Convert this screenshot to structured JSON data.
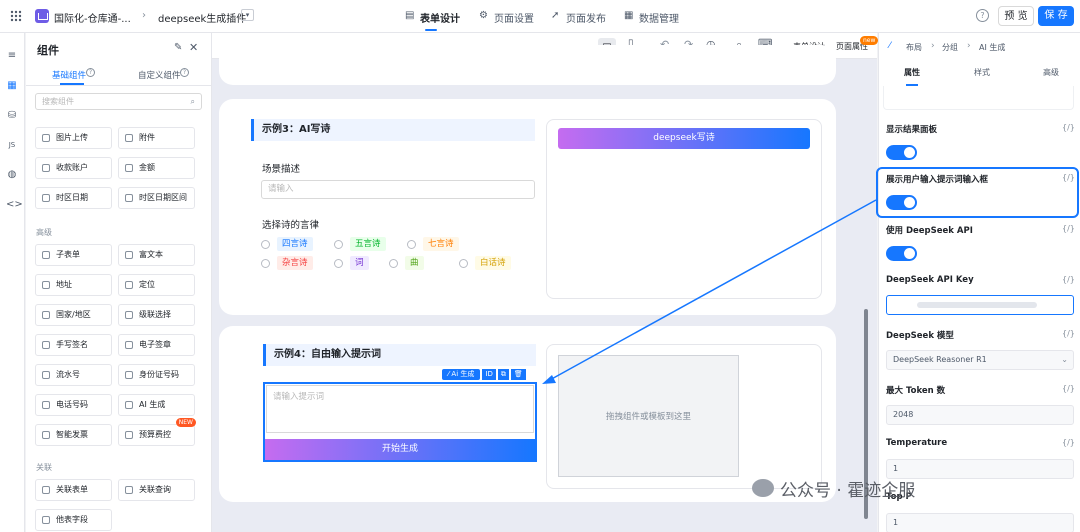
{
  "topbar": {
    "app_title": "国际化-仓库通-...",
    "page_name": "deepseek生成插件",
    "tabs": [
      "表单设计",
      "页面设置",
      "页面发布",
      "数据管理"
    ],
    "preview_label": "预 览",
    "save_label": "保 存"
  },
  "left_panel": {
    "title": "组件",
    "tabs": [
      "基础组件",
      "自定义组件"
    ],
    "search_placeholder": "搜索组件",
    "basic_items": [
      "图片上传",
      "附件",
      "收款账户",
      "金额",
      "时区日期",
      "时区日期区间"
    ],
    "advanced_group": "高级",
    "advanced_items": [
      "子表单",
      "富文本",
      "地址",
      "定位",
      "国家/地区",
      "级联选择",
      "手写签名",
      "电子签章",
      "流水号",
      "身份证号码",
      "电话号码",
      "AI 生成",
      "智能发票",
      "预算费控"
    ],
    "new_badge": "NEW",
    "relation_group": "关联",
    "relation_items": [
      "关联表单",
      "关联查询",
      "他表字段"
    ]
  },
  "canvas_toolbar": {
    "form_settings": "表单设计",
    "page_props": "页面属性",
    "new_badge": "new"
  },
  "canvas": {
    "example3_title": "示例3：AI写诗",
    "deepseek_button": "deepseek写诗",
    "scene_label": "场景描述",
    "scene_placeholder": "请输入",
    "poem_label": "选择诗的言律",
    "poem_options": [
      "四言诗",
      "五言诗",
      "七言诗",
      "杂言诗",
      "词",
      "曲",
      "白话诗"
    ],
    "example4_title": "示例4：自由输入提示词",
    "ai_toolbar_label": "Ai 生成",
    "ai_toolbar_id": "ID",
    "prompt_placeholder": "请输入提示词",
    "start_button": "开始生成",
    "drop_hint": "拖拽组件或模板到这里"
  },
  "right_panel": {
    "breadcrumb": [
      "布局",
      "分组",
      "AI 生成"
    ],
    "tabs": [
      "属性",
      "样式",
      "高级"
    ],
    "brace": "{/}",
    "fields": {
      "show_result": "显示结果面板",
      "show_prompt": "展示用户输入提示词输入框",
      "use_deepseek": "使用 DeepSeek API",
      "api_key": "DeepSeek API Key",
      "model": "DeepSeek 模型",
      "model_value": "DeepSeek Reasoner R1",
      "max_tokens": "最大 Token 数",
      "max_tokens_value": "2048",
      "temperature": "Temperature",
      "temperature_value": "1",
      "top_p": "Top P",
      "top_p_value": "1"
    },
    "toggles": {
      "show_result": true,
      "show_prompt": true,
      "use_deepseek": true
    }
  },
  "watermark": "公众号 · 霍迹企服",
  "colors": {
    "accent": "#1677ff",
    "gradient_start": "#c56cf0",
    "gradient_end": "#1677ff"
  }
}
